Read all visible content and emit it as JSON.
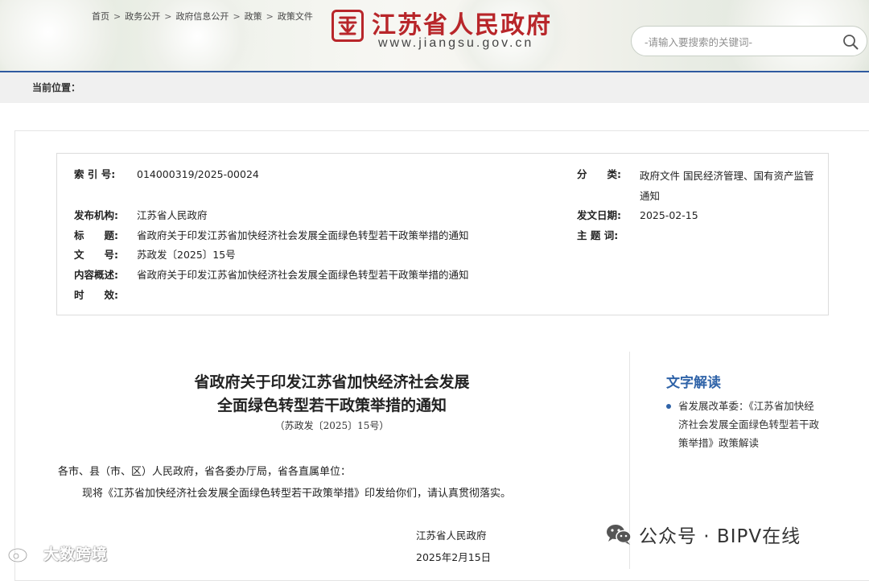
{
  "header": {
    "site_title": "江苏省人民政府",
    "site_url": "www.jiangsu.gov.cn",
    "search_placeholder": "-请输入要搜索的关键词-",
    "brand_color": "#b8262a",
    "accent_color": "#2f5aa0"
  },
  "breadcrumb": {
    "lead": "当前位置：",
    "items": [
      "首页",
      "政务公开",
      "政府信息公开",
      "政策",
      "政策文件"
    ],
    "separator": ">"
  },
  "meta": {
    "index_label": "索 引 号:",
    "index_value": "014000319/2025-00024",
    "category_label": "分　　类:",
    "category_value": "政府文件 国民经济管理、国有资产监管 通知",
    "issuer_label": "发布机构:",
    "issuer_value": "江苏省人民政府",
    "date_label": "发文日期:",
    "date_value": "2025-02-15",
    "title_label": "标　　题:",
    "title_value": "省政府关于印发江苏省加快经济社会发展全面绿色转型若干政策举措的通知",
    "keywords_label": "主 题 词:",
    "keywords_value": "",
    "docno_label": "文　　号:",
    "docno_value": "苏政发〔2025〕15号",
    "summary_label": "内容概述:",
    "summary_value": "省政府关于印发江苏省加快经济社会发展全面绿色转型若干政策举措的通知",
    "validity_label": "时　　效:",
    "validity_value": ""
  },
  "article": {
    "title_line1": "省政府关于印发江苏省加快经济社会发展",
    "title_line2": "全面绿色转型若干政策举措的通知",
    "doc_number": "（苏政发〔2025〕15号）",
    "greeting": "各市、县（市、区）人民政府，省各委办厅局，省各直属单位：",
    "body": "现将《江苏省加快经济社会发展全面绿色转型若干政策举措》印发给你们，请认真贯彻落实。",
    "signature_org": "江苏省人民政府",
    "signature_date": "2025年2月15日"
  },
  "sidebar": {
    "heading": "文字解读",
    "link_text": "省发展改革委：《江苏省加快经济社会发展全面绿色转型若干政策举措》政策解读"
  },
  "watermarks": {
    "right_text": "公众号 · BIPV在线",
    "left_text": "大数跨境"
  }
}
